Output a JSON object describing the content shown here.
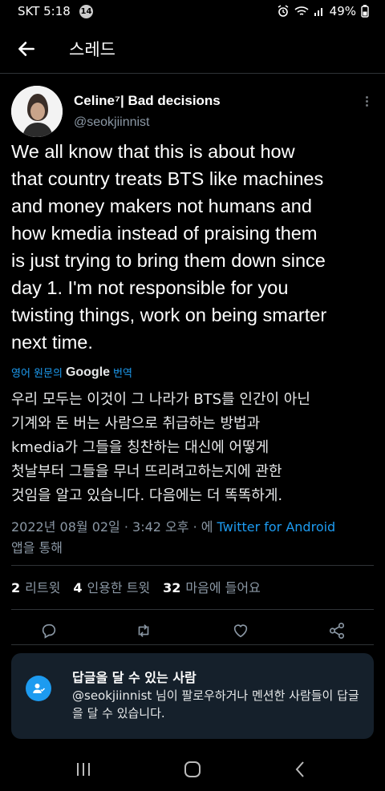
{
  "status": {
    "carrier": "SKT 5:18",
    "notification_count": "14",
    "battery": "49%"
  },
  "header": {
    "title": "스레드"
  },
  "tweet": {
    "display_name": "Celine⁷| Bad decisions",
    "handle": "@seokjiinnist",
    "text": "We all know that this is about how\nthat country treats BTS like machines\nand money makers not humans and\nhow kmedia instead of praising them\nis just trying to bring them down since\nday 1. I'm not responsible for you\ntwisting things, work on being smarter\nnext time.",
    "translate_prefix": "영어 원문의",
    "translate_provider": "Google",
    "translate_suffix": "번역",
    "translation": "우리 모두는 이것이 그 나라가 BTS를 인간이 아닌\n기계와 돈 버는 사람으로 취급하는 방법과\nkmedia가 그들을 칭찬하는 대신에 어떻게\n첫날부터 그들을 무너 뜨리려고하는지에 관한\n것임을 알고 있습니다. 다음에는 더 똑똑하게.",
    "date_text": "2022년 08월 02일 · 3:42 오후 · 에 ",
    "source": "Twitter for Android",
    "source_suffix": "앱을 통해"
  },
  "stats": {
    "retweets_count": "2",
    "retweets_label": "리트윗",
    "quotes_count": "4",
    "quotes_label": "인용한 트윗",
    "likes_count": "32",
    "likes_label": "마음에 들어요"
  },
  "reply_card": {
    "title": "답글을 달 수 있는 사람",
    "description": "@seokjiinnist 님이 팔로우하거나 멘션한 사람들이 답글을 달 수 있습니다."
  },
  "icons": {
    "back": "arrow-left-icon",
    "more": "more-vertical-icon",
    "reply": "reply-icon",
    "retweet": "retweet-icon",
    "like": "heart-icon",
    "share": "share-icon"
  },
  "colors": {
    "accent": "#1d9bf0",
    "background": "#000000",
    "card": "#15202b",
    "muted": "#8b98a5"
  }
}
